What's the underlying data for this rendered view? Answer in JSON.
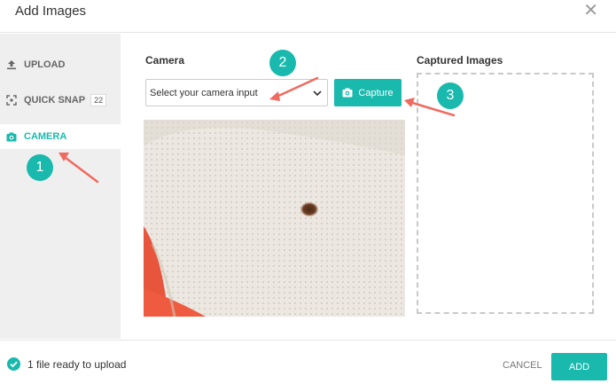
{
  "dialog": {
    "title": "Add Images"
  },
  "sidebar": {
    "items": [
      {
        "label": "UPLOAD",
        "icon": "upload-icon"
      },
      {
        "label": "QUICK SNAP",
        "icon": "quick-snap-icon",
        "badge": "22"
      },
      {
        "label": "CAMERA",
        "icon": "camera-icon",
        "active": true
      }
    ]
  },
  "camera": {
    "label": "Camera",
    "select_value": "Select your camera input",
    "capture_label": "Capture"
  },
  "captured": {
    "label": "Captured Images"
  },
  "footer": {
    "status": "1 file ready to upload",
    "cancel_label": "CANCEL",
    "add_label": "ADD"
  },
  "annotations": {
    "markers": [
      "1",
      "2",
      "3"
    ]
  },
  "colors": {
    "accent": "#19b9ad",
    "arrow": "#f06a5f"
  }
}
